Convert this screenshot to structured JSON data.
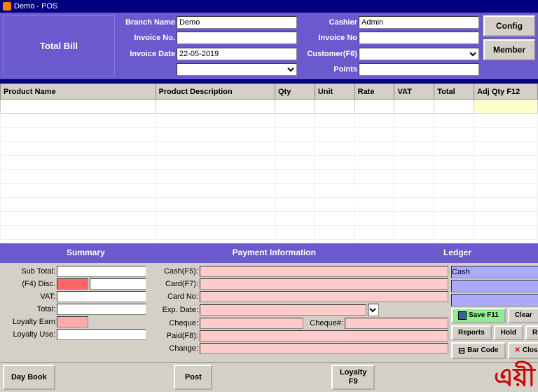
{
  "titleBar": {
    "title": "Demo - POS",
    "icon": "pos-icon"
  },
  "header": {
    "totalBill": "Total Bill",
    "fields": {
      "branchLabel": "Branch Name",
      "branchValue": "Demo",
      "cashierLabel": "Cashier",
      "cashierValue": "Admin",
      "invoiceNoLabel": "Invoice No.",
      "invoiceNoValue": "",
      "invoiceNoRightLabel": "Invoice No",
      "invoiceNoRightValue": "",
      "invoiceDateLabel": "Invoice Date",
      "invoiceDateValue": "22-05-2019",
      "customerLabel": "Customer(F6)",
      "customerValue": "",
      "pointsLabel": "Points",
      "pointsValue": ""
    },
    "buttons": {
      "config": "Config",
      "member": "Member"
    }
  },
  "table": {
    "columns": [
      "Product Name",
      "Product Description",
      "Qty",
      "Unit",
      "Rate",
      "VAT",
      "Total",
      "Adj Qty F12"
    ]
  },
  "bottomLabels": {
    "summary": "Summary",
    "payment": "Payment Information",
    "ledger": "Ledger"
  },
  "summary": {
    "subTotalLabel": "Sub Total:",
    "subTotalValue": "",
    "discLabel": "(F4) Disc.",
    "discValue": "",
    "vatLabel": "VAT:",
    "vatValue": "",
    "totalLabel": "Total:",
    "totalValue": "",
    "loyaltyEarnLabel": "Loyalty Earn",
    "loyaltyEarnValue": "",
    "loyaltyUseLabel": "Loyalty Use:",
    "loyaltyUseValue": ""
  },
  "payment": {
    "cashLabel": "Cash(F5):",
    "cashValue": "",
    "cardLabel": "Card(F7):",
    "cardValue": "",
    "cardNoLabel": "Card No:",
    "cardNoValue": "",
    "expDateLabel": "Exp. Date:",
    "expDateValue": "",
    "chequeLabel": "Cheque:",
    "chequeNoLabel": "Cheque#:",
    "chequeValue": "",
    "chequeNoValue": "",
    "paidLabel": "Paid(F8):",
    "paidValue": "",
    "changeLabel": "Change:",
    "changeValue": ""
  },
  "ledger": {
    "row1": "Cash",
    "row2": "",
    "row3": ""
  },
  "actions": {
    "saveF11": "Save F11",
    "clear": "Clear",
    "reports": "Reports",
    "hold": "Hold",
    "recall": "Recall",
    "barCode": "Bar Code",
    "close": "Close"
  },
  "toolbar": {
    "dayBook": "Day Book",
    "post": "Post",
    "loyaltyF9": "Loyalty\nF9"
  }
}
